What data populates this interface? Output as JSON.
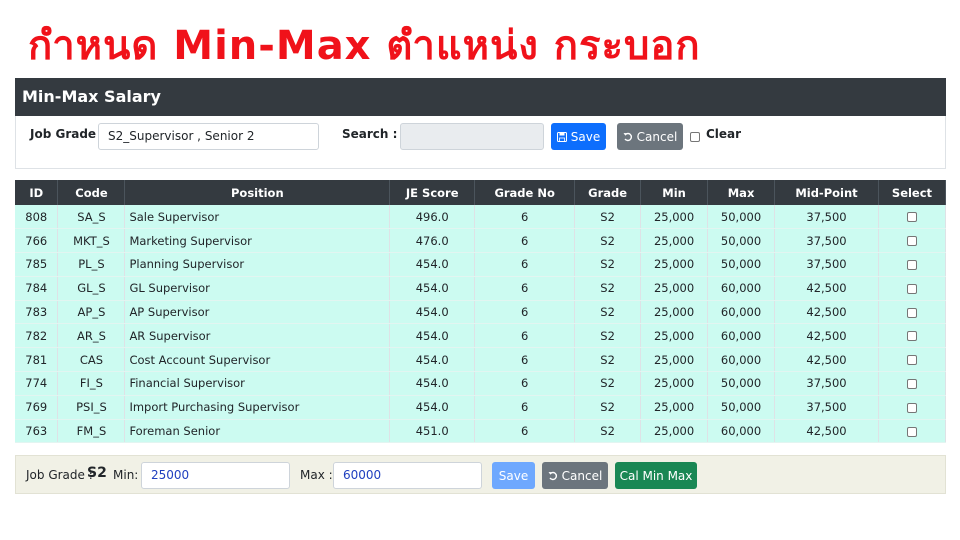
{
  "banner": {
    "title": "กำหนด Min-Max ตำแหน่ง กระบอก"
  },
  "panel": {
    "title": "Min-Max Salary",
    "job_grade_label": "Job Grade :",
    "job_grade_value": "S2_Supervisor , Senior 2",
    "search_label": "Search :",
    "search_value": "",
    "save_label": "Save",
    "cancel_label": "Cancel",
    "clear_label": "Clear"
  },
  "table": {
    "headers": [
      "ID",
      "Code",
      "Position",
      "JE Score",
      "Grade No",
      "Grade",
      "Min",
      "Max",
      "Mid-Point",
      "Select"
    ],
    "rows": [
      {
        "id": "808",
        "code": "SA_S",
        "position": "Sale Supervisor",
        "je_score": "496.0",
        "grade_no": "6",
        "grade": "S2",
        "min": "25,000",
        "max": "50,000",
        "mid": "37,500"
      },
      {
        "id": "766",
        "code": "MKT_S",
        "position": "Marketing Supervisor",
        "je_score": "476.0",
        "grade_no": "6",
        "grade": "S2",
        "min": "25,000",
        "max": "50,000",
        "mid": "37,500"
      },
      {
        "id": "785",
        "code": "PL_S",
        "position": "Planning Supervisor",
        "je_score": "454.0",
        "grade_no": "6",
        "grade": "S2",
        "min": "25,000",
        "max": "50,000",
        "mid": "37,500"
      },
      {
        "id": "784",
        "code": "GL_S",
        "position": "GL Supervisor",
        "je_score": "454.0",
        "grade_no": "6",
        "grade": "S2",
        "min": "25,000",
        "max": "60,000",
        "mid": "42,500"
      },
      {
        "id": "783",
        "code": "AP_S",
        "position": "AP Supervisor",
        "je_score": "454.0",
        "grade_no": "6",
        "grade": "S2",
        "min": "25,000",
        "max": "60,000",
        "mid": "42,500"
      },
      {
        "id": "782",
        "code": "AR_S",
        "position": "AR Supervisor",
        "je_score": "454.0",
        "grade_no": "6",
        "grade": "S2",
        "min": "25,000",
        "max": "60,000",
        "mid": "42,500"
      },
      {
        "id": "781",
        "code": "CAS",
        "position": "Cost Account Supervisor",
        "je_score": "454.0",
        "grade_no": "6",
        "grade": "S2",
        "min": "25,000",
        "max": "60,000",
        "mid": "42,500"
      },
      {
        "id": "774",
        "code": "FI_S",
        "position": "Financial Supervisor",
        "je_score": "454.0",
        "grade_no": "6",
        "grade": "S2",
        "min": "25,000",
        "max": "50,000",
        "mid": "37,500"
      },
      {
        "id": "769",
        "code": "PSI_S",
        "position": "Import Purchasing Supervisor",
        "je_score": "454.0",
        "grade_no": "6",
        "grade": "S2",
        "min": "25,000",
        "max": "50,000",
        "mid": "37,500"
      },
      {
        "id": "763",
        "code": "FM_S",
        "position": "Foreman Senior",
        "je_score": "451.0",
        "grade_no": "6",
        "grade": "S2",
        "min": "25,000",
        "max": "60,000",
        "mid": "42,500"
      }
    ]
  },
  "footer": {
    "job_grade_label": "Job Grade :",
    "job_grade_value": "S2",
    "min_label": "Min:",
    "min_value": "25000",
    "max_label": "Max :",
    "max_value": "60000",
    "save_label": "Save",
    "cancel_label": "Cancel",
    "cal_label": "Cal Min Max"
  },
  "icons": {
    "save": "floppy-disk-icon",
    "cancel": "undo-icon"
  },
  "colors": {
    "banner": "#f0121a",
    "header": "#343a40",
    "row_bg": "#ccfbf1",
    "primary": "#0d6efd",
    "secondary": "#6c757d",
    "success": "#198754"
  }
}
